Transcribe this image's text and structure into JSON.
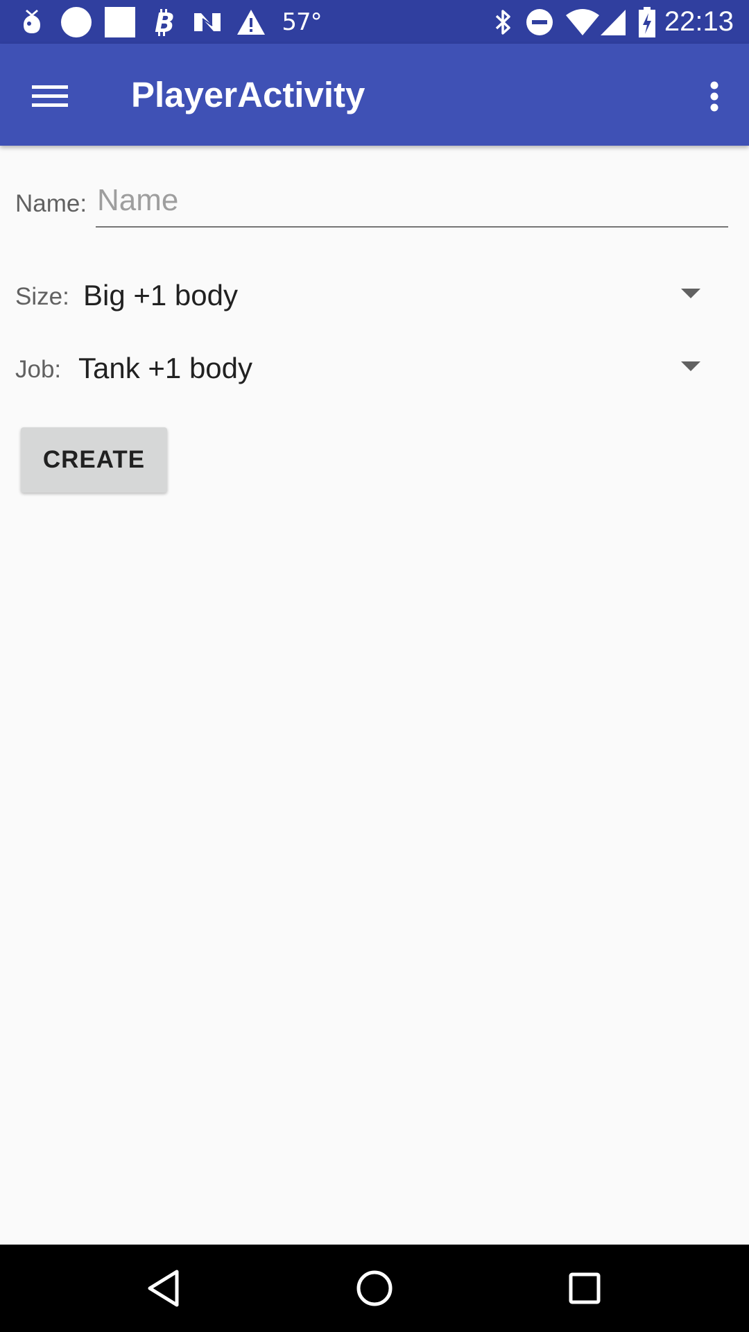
{
  "status_bar": {
    "temperature": "57°",
    "time": "22:13",
    "left_icons": [
      "notification-pear-icon",
      "circle-icon",
      "square-icon",
      "bitcoin-icon",
      "n-logo-icon",
      "warning-icon"
    ],
    "right_icons": [
      "bluetooth-icon",
      "do-not-disturb-icon",
      "wifi-icon",
      "signal-icon",
      "battery-charging-icon"
    ]
  },
  "app_bar": {
    "title": "PlayerActivity",
    "background": "#3f51b5"
  },
  "form": {
    "name_label": "Name:",
    "name_placeholder": "Name",
    "name_value": "",
    "size_label": "Size:",
    "size_selected": "Big +1 body",
    "job_label": "Job:",
    "job_selected": "Tank +1 body",
    "create_label": "CREATE"
  },
  "nav_bar": {
    "buttons": [
      "back",
      "home",
      "recents"
    ]
  }
}
